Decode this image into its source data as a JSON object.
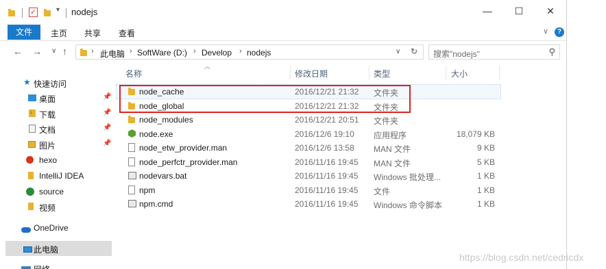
{
  "window": {
    "title": "nodejs",
    "minimize": "—",
    "maximize": "☐",
    "close": "✕"
  },
  "ribbon": {
    "tabs": [
      "文件",
      "主页",
      "共享",
      "查看"
    ],
    "help": "?"
  },
  "address": {
    "crumbs": [
      "此电脑",
      "SoftWare (D:)",
      "Develop",
      "nodejs"
    ],
    "search_placeholder": "搜索\"nodejs\""
  },
  "navpane": {
    "items": [
      {
        "label": "快速访问",
        "icon": "star-icon"
      },
      {
        "label": "桌面",
        "icon": "desktop-icon",
        "pinned": true
      },
      {
        "label": "下载",
        "icon": "download-icon",
        "pinned": true
      },
      {
        "label": "文档",
        "icon": "document-icon",
        "pinned": true
      },
      {
        "label": "图片",
        "icon": "pictures-icon",
        "pinned": true
      },
      {
        "label": "hexo",
        "icon": "hexo-icon"
      },
      {
        "label": "IntelliJ IDEA",
        "icon": "folder-icon"
      },
      {
        "label": "source",
        "icon": "source-icon"
      },
      {
        "label": "视频",
        "icon": "folder-icon"
      },
      {
        "label": "OneDrive",
        "icon": "onedrive-icon"
      },
      {
        "label": "此电脑",
        "icon": "computer-icon",
        "selected": true
      },
      {
        "label": "网络",
        "icon": "network-icon"
      }
    ],
    "pin_glyph": "📌"
  },
  "columns": {
    "name": "名称",
    "date": "修改日期",
    "type": "类型",
    "size": "大小"
  },
  "files": [
    {
      "name": "node_cache",
      "date": "2016/12/21 21:32",
      "type": "文件夹",
      "size": "",
      "icon": "folder-icon"
    },
    {
      "name": "node_global",
      "date": "2016/12/21 21:32",
      "type": "文件夹",
      "size": "",
      "icon": "folder-icon"
    },
    {
      "name": "node_modules",
      "date": "2016/12/21 20:51",
      "type": "文件夹",
      "size": "",
      "icon": "folder-icon"
    },
    {
      "name": "node.exe",
      "date": "2016/12/6 19:10",
      "type": "应用程序",
      "size": "18,079 KB",
      "icon": "node-exe-icon"
    },
    {
      "name": "node_etw_provider.man",
      "date": "2016/12/6 13:58",
      "type": "MAN 文件",
      "size": "9 KB",
      "icon": "file-icon"
    },
    {
      "name": "node_perfctr_provider.man",
      "date": "2016/11/16 19:45",
      "type": "MAN 文件",
      "size": "5 KB",
      "icon": "file-icon"
    },
    {
      "name": "nodevars.bat",
      "date": "2016/11/16 19:45",
      "type": "Windows 批处理...",
      "size": "1 KB",
      "icon": "batch-file-icon"
    },
    {
      "name": "npm",
      "date": "2016/11/16 19:45",
      "type": "文件",
      "size": "1 KB",
      "icon": "file-icon"
    },
    {
      "name": "npm.cmd",
      "date": "2016/11/16 19:45",
      "type": "Windows 命令脚本",
      "size": "1 KB",
      "icon": "batch-file-icon"
    }
  ],
  "watermark": "https://blog.csdn.net/cedricdx",
  "colors": {
    "accent": "#1979ca",
    "highlight_box": "#e02020",
    "folder": "#e8b330"
  }
}
